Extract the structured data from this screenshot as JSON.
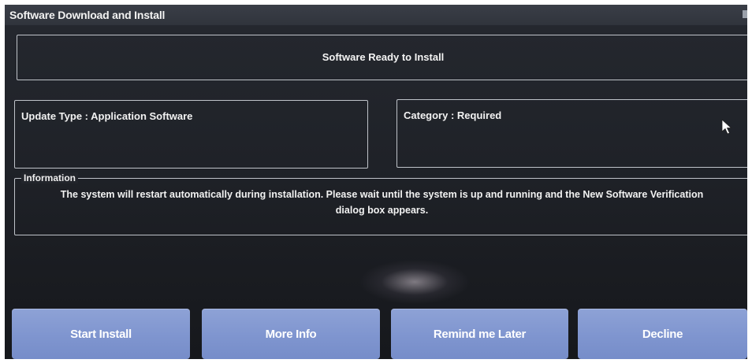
{
  "window": {
    "title": "Software Download and Install"
  },
  "status": {
    "message": "Software Ready to Install"
  },
  "details": {
    "update_type": "Update Type : Application Software",
    "category": "Category : Required"
  },
  "information": {
    "legend": "Information",
    "text": "The system will restart automatically during installation. Please wait until the system is up and running and the New Software Verification dialog box appears."
  },
  "buttons": {
    "start_install": "Start Install",
    "more_info": "More Info",
    "remind_later": "Remind me Later",
    "decline": "Decline"
  },
  "colors": {
    "button_fill": "#8199d1",
    "background": "#1f2228",
    "text": "#f2f2f2"
  },
  "icons": {
    "cursor": "mouse-pointer-icon"
  }
}
